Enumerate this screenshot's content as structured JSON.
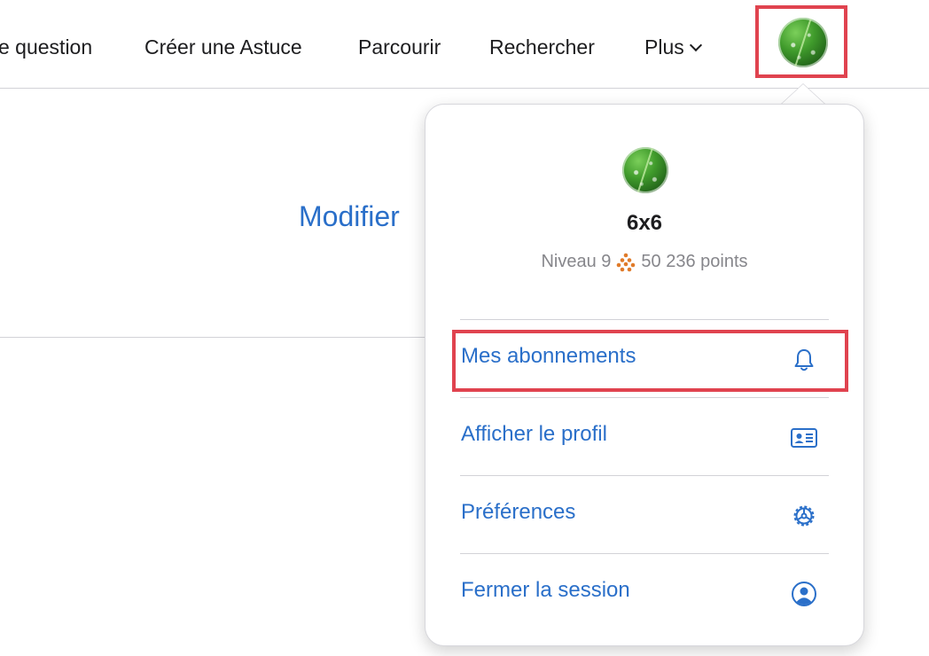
{
  "nav": {
    "items": [
      {
        "label": "e question"
      },
      {
        "label": "Créer une Astuce"
      },
      {
        "label": "Parcourir"
      },
      {
        "label": "Rechercher"
      },
      {
        "label": "Plus"
      }
    ]
  },
  "page": {
    "edit_link": "Modifier"
  },
  "profile_menu": {
    "username": "6x6",
    "level_label": "Niveau 9",
    "points": "50 236 points",
    "items": [
      {
        "label": "Mes abonnements",
        "icon": "bell-icon"
      },
      {
        "label": "Afficher le profil",
        "icon": "id-card-icon"
      },
      {
        "label": "Préférences",
        "icon": "gear-icon"
      },
      {
        "label": "Fermer la session",
        "icon": "user-circle-icon"
      }
    ]
  },
  "colors": {
    "link": "#2a6fc9",
    "highlight": "#e0434f",
    "points_icon": "#e07b2a"
  }
}
